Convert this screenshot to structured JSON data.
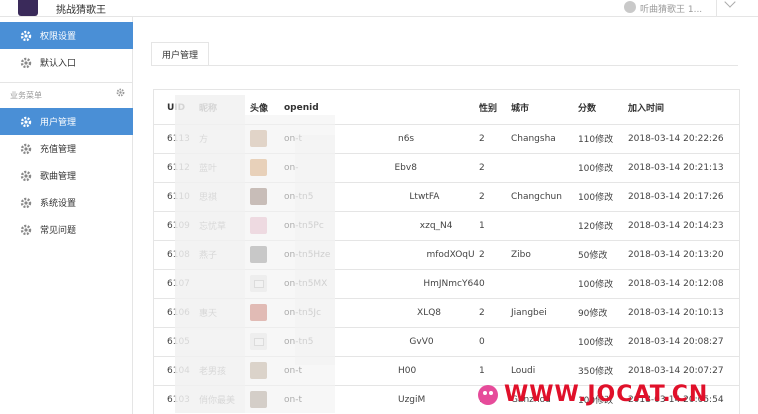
{
  "topbar": {
    "logo_text": "挑战猜歌王",
    "title": "挑战猜歌王",
    "user": "听曲猜歌王 1..."
  },
  "sidebar": {
    "top_items": [
      {
        "label": "权限设置",
        "icon": "gear-icon",
        "active": true
      },
      {
        "label": "默认入口",
        "icon": "gear-icon",
        "active": false
      }
    ],
    "section_label": "业务菜单",
    "items": [
      {
        "label": "用户管理",
        "icon": "gear-icon",
        "active": true
      },
      {
        "label": "充值管理",
        "icon": "gear-icon",
        "active": false
      },
      {
        "label": "歌曲管理",
        "icon": "gear-icon",
        "active": false
      },
      {
        "label": "系统设置",
        "icon": "gear-icon",
        "active": false
      },
      {
        "label": "常见问题",
        "icon": "gear-icon",
        "active": false
      }
    ]
  },
  "main": {
    "tab": "用户管理",
    "columns": [
      "UID",
      "昵称",
      "头像",
      "openid",
      "性别",
      "城市",
      "分数",
      "加入时间"
    ],
    "rows": [
      {
        "uid": "6113",
        "name": "方",
        "avatar": "photo",
        "openid": "on-t",
        "openid_end": "n6s",
        "sex": "2",
        "city": "Changsha",
        "score": "110修改",
        "time": "2018-03-14 20:22:26"
      },
      {
        "uid": "6112",
        "name": "蓝叶",
        "avatar": "photo",
        "openid": "on-",
        "openid_end": "Ebv8",
        "sex": "2",
        "city": "",
        "score": "100修改",
        "time": "2018-03-14 20:21:13"
      },
      {
        "uid": "6110",
        "name": "思祺",
        "avatar": "photo",
        "openid": "on-tn5",
        "openid_end": "LtwtFA",
        "sex": "2",
        "city": "Changchun",
        "score": "100修改",
        "time": "2018-03-14 20:17:26"
      },
      {
        "uid": "6109",
        "name": "忘忧草",
        "avatar": "photo",
        "openid": "on-tn5Pc",
        "openid_end": "xzq_N4",
        "sex": "1",
        "city": "",
        "score": "120修改",
        "time": "2018-03-14 20:14:23"
      },
      {
        "uid": "6108",
        "name": "燕子",
        "avatar": "photo",
        "openid": "on-tn5Hze",
        "openid_end": "mfodXOqU",
        "sex": "2",
        "city": "Zibo",
        "score": "50修改",
        "time": "2018-03-14 20:13:20"
      },
      {
        "uid": "6107",
        "name": "",
        "avatar": "placeholder",
        "openid": "on-tn5MX",
        "openid_end": "HmJNmcY64",
        "sex": "0",
        "city": "",
        "score": "100修改",
        "time": "2018-03-14 20:12:08"
      },
      {
        "uid": "6106",
        "name": "惠天",
        "avatar": "photo",
        "openid": "on-tn5Jc",
        "openid_end": "XLQ8",
        "sex": "2",
        "city": "Jiangbei",
        "score": "90修改",
        "time": "2018-03-14 20:10:13"
      },
      {
        "uid": "6105",
        "name": "",
        "avatar": "placeholder",
        "openid": "on-tn5",
        "openid_end": "GvV0",
        "sex": "0",
        "city": "",
        "score": "100修改",
        "time": "2018-03-14 20:08:27"
      },
      {
        "uid": "6104",
        "name": "老男孩",
        "avatar": "photo",
        "openid": "on-t",
        "openid_end": "H00",
        "sex": "1",
        "city": "Loudi",
        "score": "350修改",
        "time": "2018-03-14 20:07:27"
      },
      {
        "uid": "6103",
        "name": "俏你最美",
        "avatar": "photo",
        "openid": "on-t",
        "openid_end": "UzgiM",
        "sex": "1",
        "city": "Ganzhou",
        "score": "100修改",
        "time": "2018-03-14 20:05:54"
      }
    ]
  },
  "watermark": "WWW.JOCAT.CN",
  "avatar_colors": [
    "#c9a98a",
    "#d9a066",
    "#8a6e62",
    "#e8b7c8",
    "#8b8b8b",
    "#eeeeee",
    "#c96a5a",
    "#eeeeee",
    "#b9a58f",
    "#a89a8a"
  ]
}
